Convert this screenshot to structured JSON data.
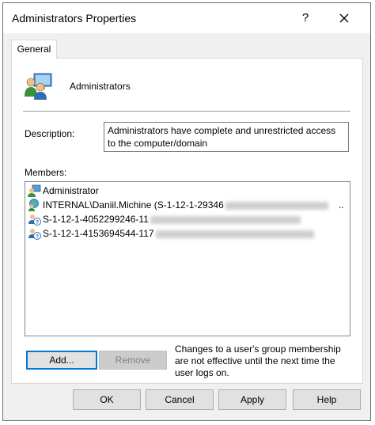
{
  "window": {
    "title": "Administrators Properties",
    "help_label": "?"
  },
  "tabs": [
    {
      "label": "General"
    }
  ],
  "group": {
    "name": "Administrators"
  },
  "description": {
    "label": "Description:",
    "value": "Administrators have complete and unrestricted access to the computer/domain"
  },
  "members": {
    "label": "Members:",
    "items": [
      {
        "text": "Administrator",
        "icon": "user-icon"
      },
      {
        "text": "INTERNAL\\Daniil.Michine (S-1-12-1-29346",
        "icon": "domain-user-icon",
        "trailing": ".."
      },
      {
        "text": "S-1-12-1-4052299246-11",
        "icon": "unknown-user-icon"
      },
      {
        "text": "S-1-12-1-4153694544-117",
        "icon": "unknown-user-icon"
      }
    ]
  },
  "actions": {
    "add_label": "Add...",
    "remove_label": "Remove",
    "note": "Changes to a user's group membership are not effective until the next time the user logs on."
  },
  "footer": {
    "ok_label": "OK",
    "cancel_label": "Cancel",
    "apply_label": "Apply",
    "help_label": "Help"
  },
  "colors": {
    "focus_border": "#0078d7",
    "dialog_bg": "#f0f0f0",
    "panel_bg": "#ffffff"
  }
}
